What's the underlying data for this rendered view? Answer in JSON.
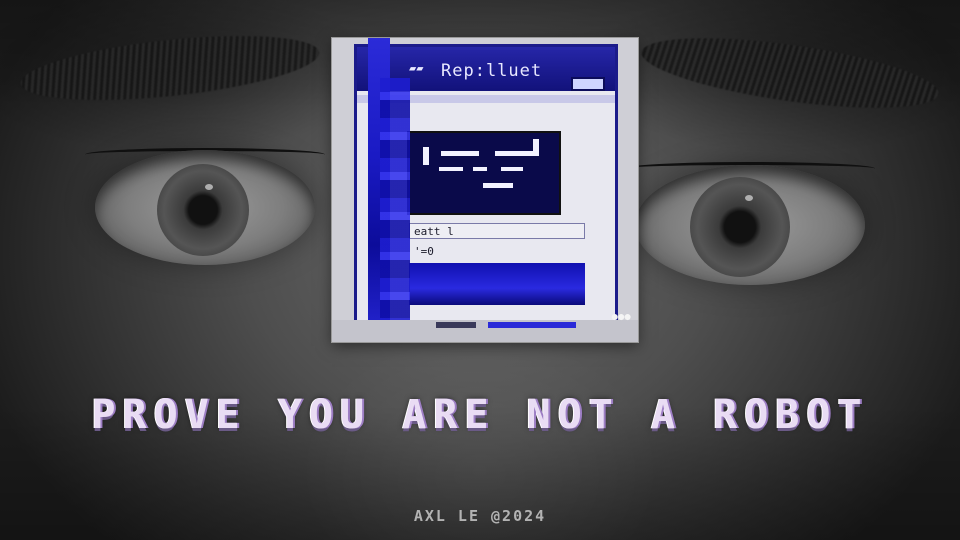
{
  "thumbnail": {
    "window_title": "Rep:lluet",
    "field_1": "eatt l",
    "field_2": "'=0"
  },
  "headline": "PROVE YOU ARE NOT A ROBOT",
  "credit": "AXL LE @2024"
}
